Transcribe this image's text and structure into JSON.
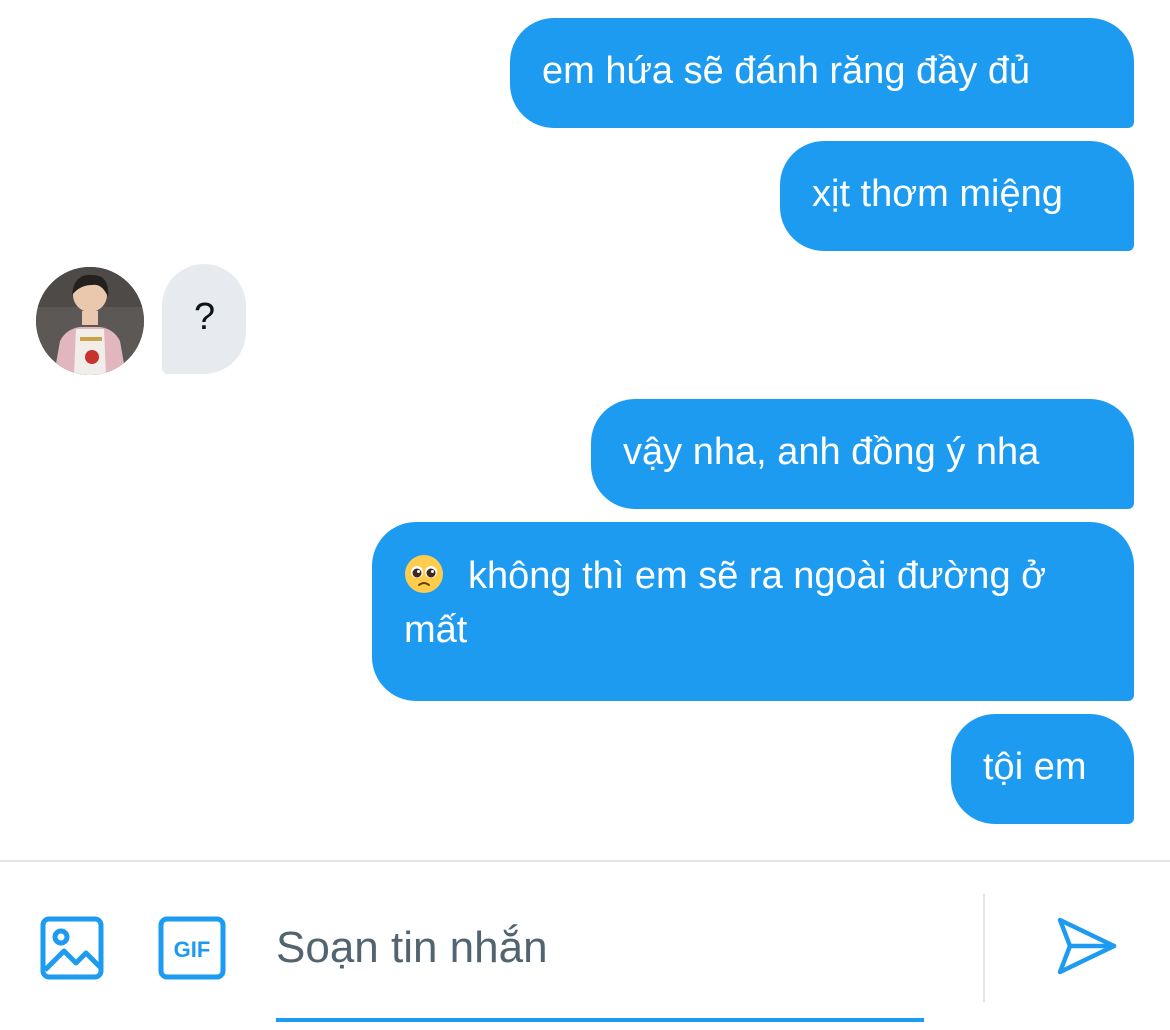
{
  "conversation": {
    "messages": [
      {
        "direction": "outgoing",
        "text": "em hứa sẽ đánh răng đầy đủ"
      },
      {
        "direction": "outgoing",
        "text": "xịt thơm miệng"
      },
      {
        "direction": "incoming",
        "text": "?"
      },
      {
        "direction": "outgoing",
        "text": "vậy nha, anh đồng ý nha"
      },
      {
        "direction": "outgoing",
        "emoji": "pleading-face",
        "text": "không thì em sẽ ra ngoài đường ở mất"
      },
      {
        "direction": "outgoing",
        "text": "tội em"
      }
    ]
  },
  "composer": {
    "placeholder": "Soạn tin nhắn",
    "value": "",
    "image_icon": "image-icon",
    "gif_label": "GIF",
    "send_icon": "send-icon"
  },
  "colors": {
    "accent": "#1d9bf0",
    "incoming_bubble": "#e7ebef",
    "text_dark": "#0f1419",
    "placeholder": "#536471",
    "divider": "#e4e7ea"
  }
}
